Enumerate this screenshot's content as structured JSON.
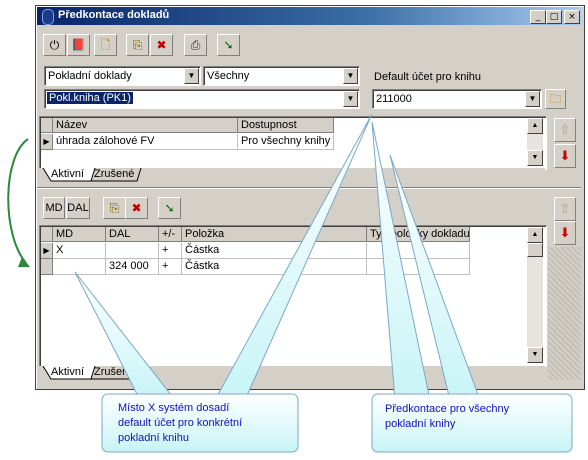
{
  "window": {
    "title": "Předkontace dokladů"
  },
  "toolbar": {
    "md_label": "MD",
    "dal_label": "DAL"
  },
  "filters": {
    "doc_type": "Pokladní doklady",
    "scope": "Všechny",
    "book": "Pokl.kniha (PK1)",
    "default_account_label": "Default účet pro knihu",
    "default_account_value": "211000"
  },
  "upper_grid": {
    "columns": [
      "Název",
      "Dostupnost"
    ],
    "rows": [
      {
        "name": "úhrada zálohové FV",
        "availability": "Pro všechny knihy"
      }
    ],
    "tabs": [
      "Aktivní",
      "Zrušené"
    ]
  },
  "lower_grid": {
    "columns": [
      "MD",
      "DAL",
      "+/-",
      "Položka",
      "Typ položky dokladu"
    ],
    "rows": [
      {
        "md": "X",
        "dal": "",
        "sign": "+",
        "item": "Částka",
        "type": ""
      },
      {
        "md": "",
        "dal": "324 000",
        "sign": "+",
        "item": "Částka",
        "type": ""
      }
    ],
    "tabs": [
      "Aktivní",
      "Zrušené"
    ]
  },
  "callouts": {
    "left": [
      "Místo X systém dosadí",
      "default účet pro konkrétní",
      "pokladní knihu"
    ],
    "right": [
      "Předkontace pro všechny",
      "pokladní knihy"
    ]
  },
  "colors": {
    "titlebar": "#0a246a",
    "callout_fill": "#e8fbfb",
    "callout_text": "#1010c0",
    "selection": "#0a246a"
  }
}
